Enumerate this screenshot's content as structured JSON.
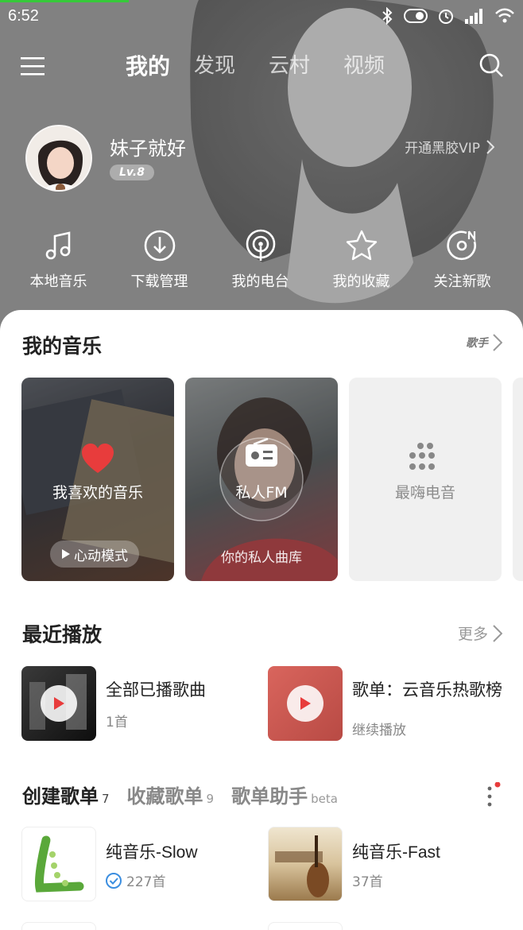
{
  "status": {
    "time": "6:52"
  },
  "nav": {
    "tabs": [
      {
        "label": "我的",
        "active": true
      },
      {
        "label": "发现",
        "active": false
      },
      {
        "label": "云村",
        "active": false
      },
      {
        "label": "视频",
        "active": false
      }
    ]
  },
  "profile": {
    "name": "妹子就好",
    "level": "Lv.8",
    "vip_link": "开通黑胶VIP"
  },
  "quick_actions": [
    {
      "label": "本地音乐",
      "icon": "music-note-icon"
    },
    {
      "label": "下载管理",
      "icon": "download-icon"
    },
    {
      "label": "我的电台",
      "icon": "radio-podcast-icon"
    },
    {
      "label": "我的收藏",
      "icon": "star-icon"
    },
    {
      "label": "关注新歌",
      "icon": "new-song-disc-icon"
    }
  ],
  "my_music": {
    "title": "我的音乐",
    "right_badge": "歌手",
    "cards": [
      {
        "title": "我喜欢的音乐",
        "button": "心动模式"
      },
      {
        "title": "私人FM",
        "subtitle": "你的私人曲库"
      },
      {
        "title": "最嗨电音"
      }
    ]
  },
  "recent": {
    "title": "最近播放",
    "more": "更多",
    "items": [
      {
        "title": "全部已播歌曲",
        "sub": "1首"
      },
      {
        "title": "歌单：云音乐热歌榜",
        "sub": "继续播放"
      }
    ]
  },
  "playlist_tabs": [
    {
      "label": "创建歌单",
      "count": "7",
      "active": true
    },
    {
      "label": "收藏歌单",
      "count": "9",
      "active": false
    },
    {
      "label": "歌单助手",
      "count": "beta",
      "active": false
    }
  ],
  "playlists": [
    {
      "name": "纯音乐-Slow",
      "count": "227首",
      "verified": true
    },
    {
      "name": "纯音乐-Fast",
      "count": "37首",
      "verified": false
    }
  ],
  "colors": {
    "accent_red": "#e83c3c",
    "progress_green": "#36c93a",
    "verified_blue": "#3b8ee0"
  }
}
